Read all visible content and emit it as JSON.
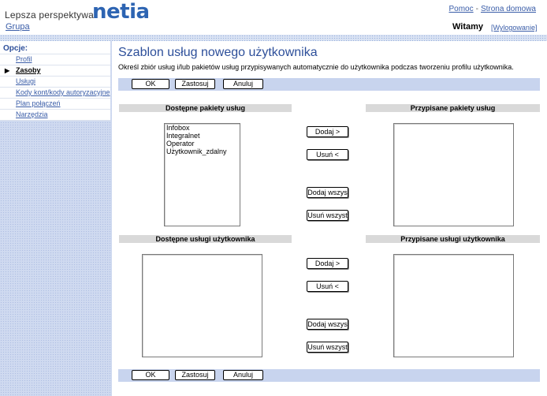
{
  "header": {
    "tagline": "Lepsza perspektywa",
    "brand": "netia",
    "group_link": "Grupa",
    "help_link": "Pomoc",
    "separator": "-",
    "home_link": "Strona domowa",
    "welcome": "Witamy",
    "logout": "[Wylogowanie]"
  },
  "sidebar": {
    "title": "Opcje:",
    "items": [
      {
        "label": "Profil"
      },
      {
        "label": "Zasoby"
      },
      {
        "label": "Usługi"
      },
      {
        "label": "Kody kont/kody autoryzacyjne"
      },
      {
        "label": "Plan połączeń"
      },
      {
        "label": "Narzędzia"
      }
    ],
    "active_marker": "▶"
  },
  "main": {
    "title": "Szablon usług nowego użytkownika",
    "description": "Określ zbiór usług i/lub pakietów usług przypisywanych automatycznie do użytkownika podczas tworzeniu profilu użytkownika.",
    "buttons": {
      "ok": "OK",
      "apply": "Zastosuj",
      "cancel": "Anuluj"
    },
    "packages": {
      "available_header": "Dostępne pakiety usług",
      "assigned_header": "Przypisane pakiety usług",
      "available_items": [
        "Infobox",
        "Integralnet",
        "Operator",
        "Użytkownik_zdalny"
      ],
      "assigned_items": []
    },
    "services": {
      "available_header": "Dostępne usługi użytkownika",
      "assigned_header": "Przypisane usługi użytkownika",
      "available_items": [],
      "assigned_items": []
    },
    "move": {
      "add": "Dodaj >",
      "remove": "Usuń <",
      "add_all": "Dodaj wszys",
      "remove_all": "Usuń wszyst"
    }
  }
}
